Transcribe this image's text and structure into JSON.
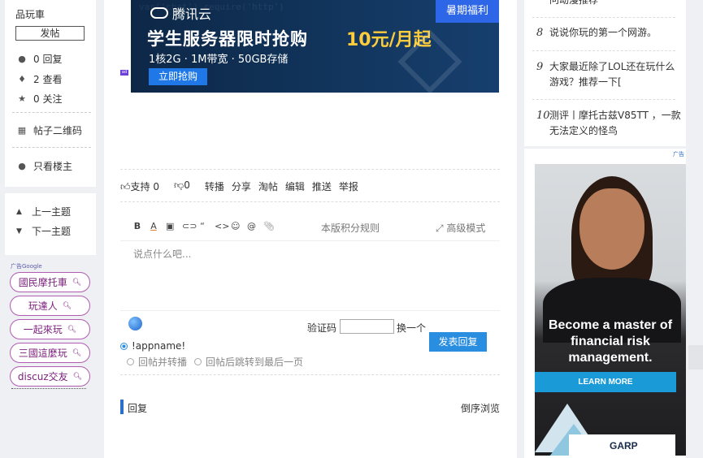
{
  "sidebar": {
    "username": "品玩車",
    "post_button": "发帖",
    "stats": {
      "replies": "0 回复",
      "views": "2 查看",
      "follows": "0 关注"
    },
    "qr_code": "帖子二维码",
    "only_author": "只看楼主"
  },
  "thread_nav": {
    "prev": "上一主题",
    "next": "下一主题"
  },
  "left_ad": {
    "label": "广告Google",
    "keywords": [
      "國民摩托車",
      "玩達人",
      "一起來玩",
      "三國這麼玩",
      "discuz交友"
    ]
  },
  "banner_ad": {
    "code_bg": "var('chat')  require('http')",
    "brand": "腾讯云",
    "tag": "暑期福利",
    "headline": "学生服务器限时抢购",
    "price": "10元/月起",
    "spec": "1核2G · 1M带宽 · 50GB存储",
    "cta": "立即抢购",
    "chip": "ad"
  },
  "post_actions": {
    "support": "支持 0",
    "oppose": "0",
    "repost": "转播",
    "share": "分享",
    "taobao": "淘帖",
    "edit": "编辑",
    "recommend": "推送",
    "report": "举报"
  },
  "editor": {
    "toolbar": [
      "B",
      "A",
      "▣",
      "⊂⊃",
      "“",
      "<>",
      "☺",
      "@"
    ],
    "rules_link": "本版积分规则",
    "advanced_mode": "高级模式",
    "placeholder": "说点什么吧..."
  },
  "reply_form": {
    "captcha_label": "验证码",
    "captcha_change": "换一个",
    "submit": "发表回复",
    "option_appname": "!appname!",
    "option_repost": "回帖并转播",
    "option_jump_last": "回帖后跳转到最后一页"
  },
  "replies_section": {
    "title": "回复",
    "order": "倒序浏览"
  },
  "rankings": [
    {
      "no": "",
      "title": "问动漫推荐"
    },
    {
      "no": "8",
      "title": "说说你玩的第一个网游。"
    },
    {
      "no": "9",
      "title": "大家最近除了LOL还在玩什么游戏？推荐一下["
    },
    {
      "no": "10",
      "title": "测评丨摩托古兹V85TT ，一款无法定义的怪鸟"
    }
  ],
  "right_ad": {
    "ad_mark": "广告",
    "headline": "Become a master of financial risk management.",
    "cta": "LEARN MORE",
    "logo": "GARP"
  }
}
